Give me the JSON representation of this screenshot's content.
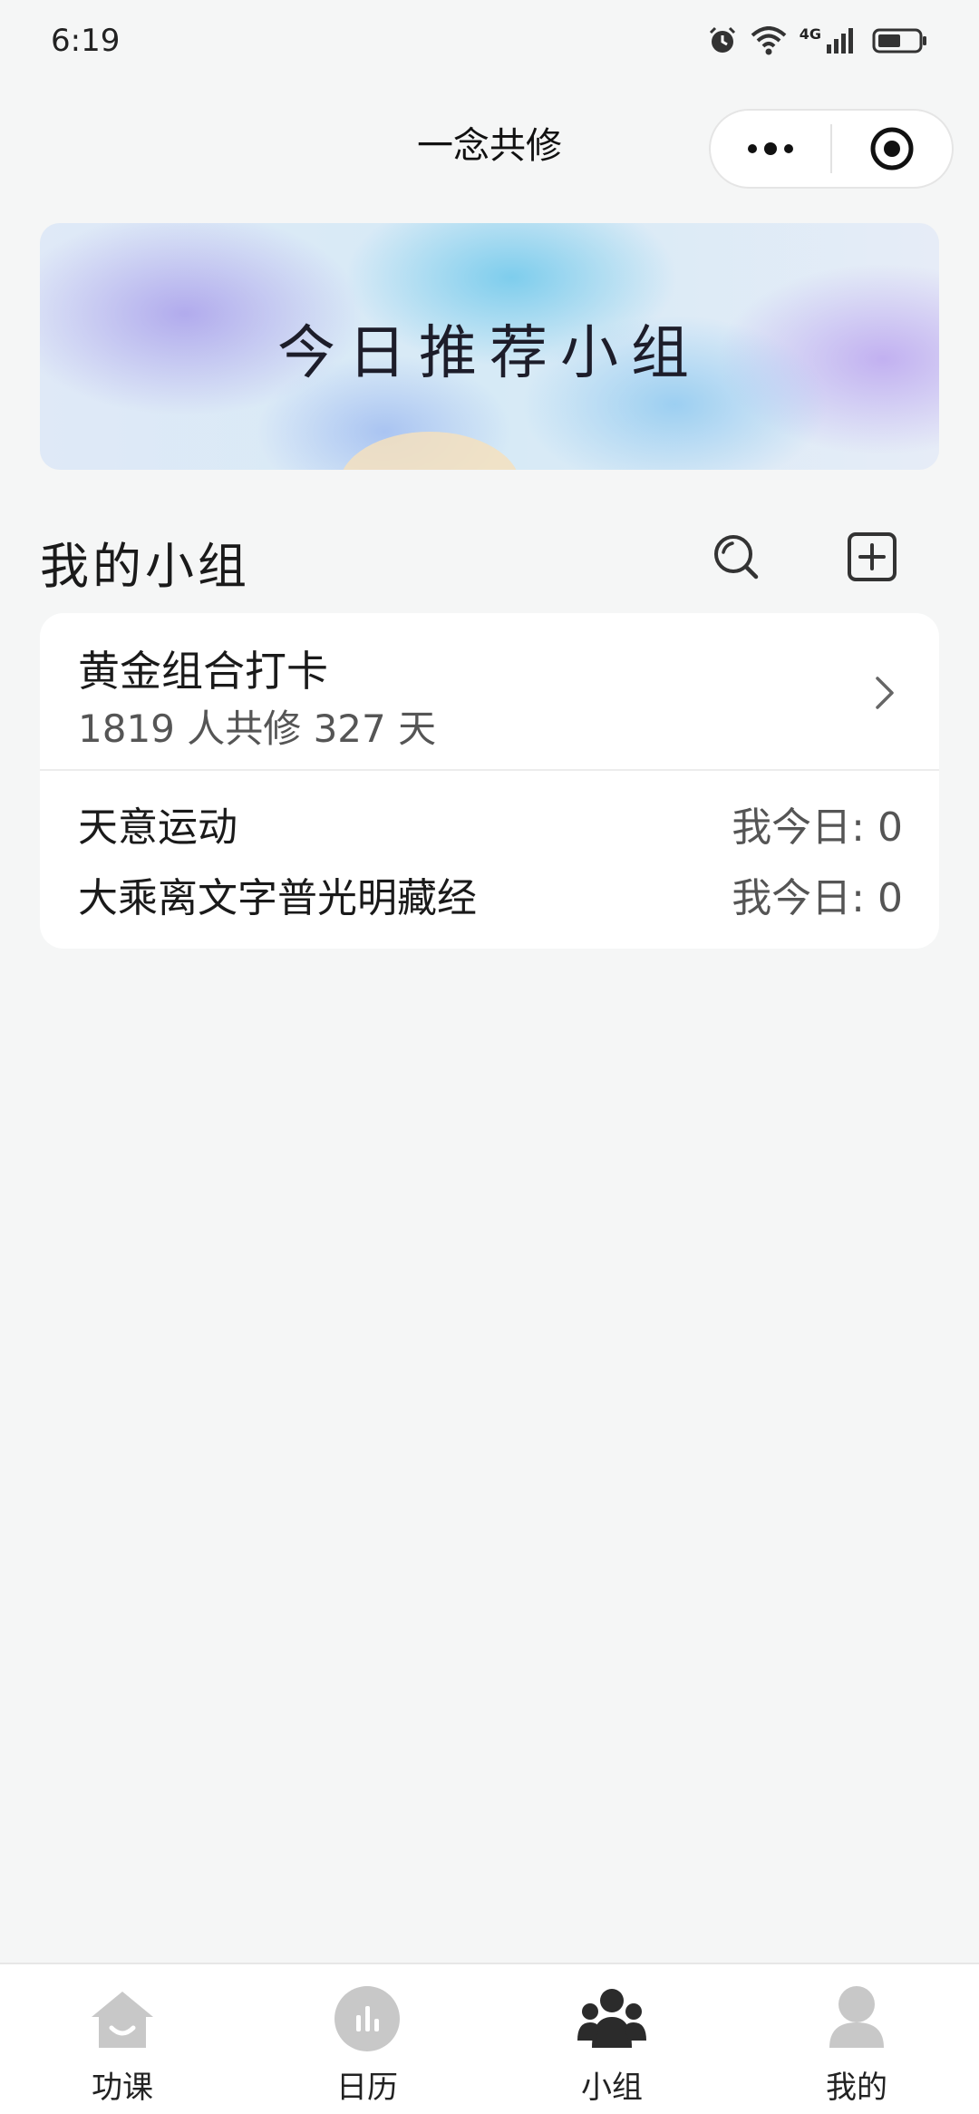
{
  "status_bar": {
    "time": "6:19",
    "network": "4G",
    "icons": [
      "alarm-icon",
      "wifi-icon",
      "signal-icon",
      "battery-icon"
    ]
  },
  "nav": {
    "title": "一念共修",
    "more_icon": "more-dots-icon",
    "close_icon": "target-icon"
  },
  "banner": {
    "title": "今日推荐小组"
  },
  "my_groups": {
    "title": "我的小组",
    "search_icon": "search-icon",
    "add_icon": "add-square-icon",
    "featured": {
      "name": "黄金组合打卡",
      "stats": "1819 人共修 327 天"
    },
    "items": [
      {
        "name": "天意运动",
        "today": "我今日: 0"
      },
      {
        "name": "大乘离文字普光明藏经",
        "today": "我今日: 0"
      }
    ]
  },
  "tabs": [
    {
      "label": "功课",
      "icon": "home-icon",
      "active": false
    },
    {
      "label": "日历",
      "icon": "calendar-icon",
      "active": false
    },
    {
      "label": "小组",
      "icon": "group-icon",
      "active": true
    },
    {
      "label": "我的",
      "icon": "profile-icon",
      "active": false
    }
  ],
  "colors": {
    "background": "#f5f6f6",
    "card": "#ffffff",
    "tab_active": "#2b2b2b",
    "tab_inactive": "#c8c8c8"
  }
}
